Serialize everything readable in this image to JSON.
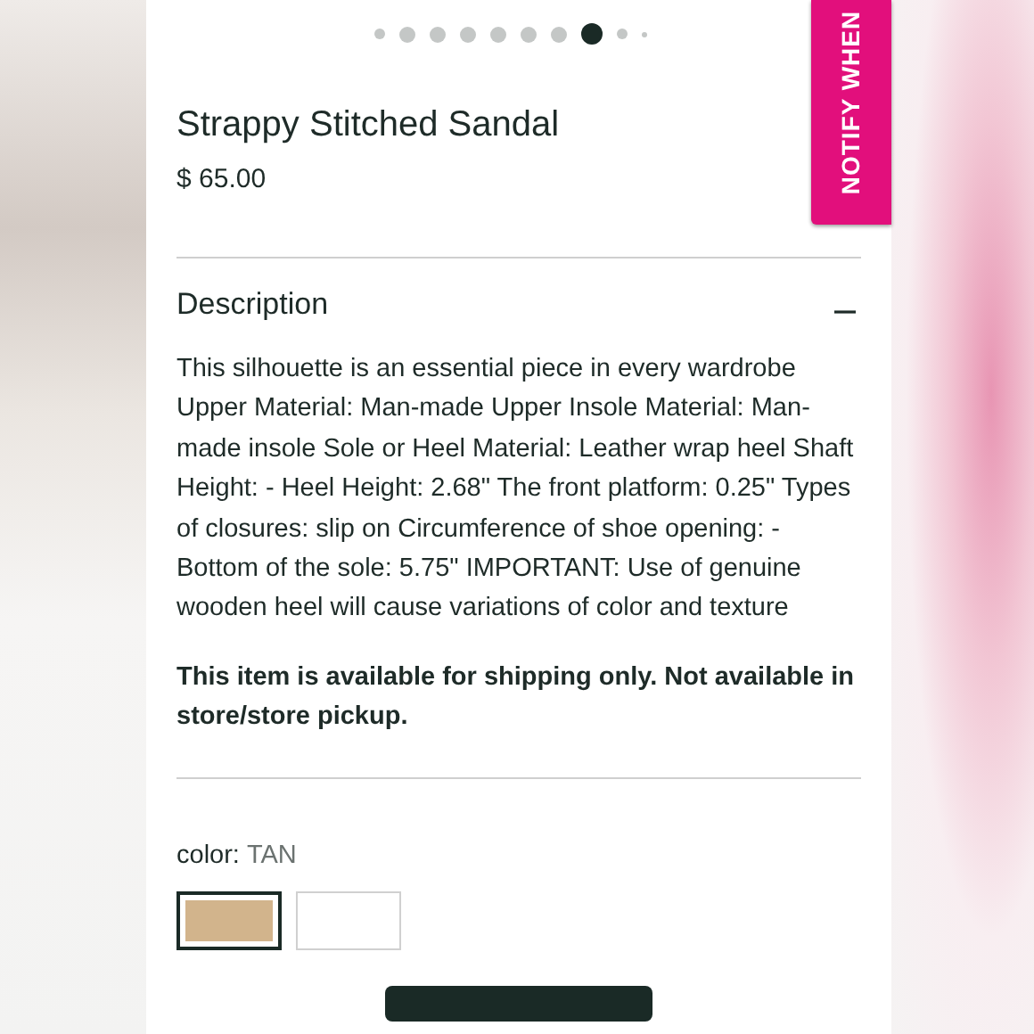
{
  "carousel_dots": [
    {
      "selected": false
    },
    {
      "selected": false
    },
    {
      "selected": false
    },
    {
      "selected": false
    },
    {
      "selected": false
    },
    {
      "selected": false
    },
    {
      "selected": false
    },
    {
      "selected": true
    },
    {
      "selected": false
    },
    {
      "selected": false
    }
  ],
  "notify_tab": {
    "label": "NOTIFY WHEN"
  },
  "product": {
    "title": "Strappy Stitched Sandal",
    "price": "$ 65.00"
  },
  "description": {
    "heading": "Description",
    "expanded": true,
    "body": "This silhouette is an essential piece in every wardrobe Upper Material: Man-made Upper Insole Material: Man-made insole Sole or Heel Material: Leather wrap heel Shaft Height: - Heel Height: 2.68\" The front platform: 0.25\" Types of closures: slip on Circumference of shoe opening: - Bottom of the sole: 5.75\" IMPORTANT: Use of genuine wooden heel will cause variations of color and texture",
    "notice": "This item is available for shipping only. Not available in store/store pickup."
  },
  "color_picker": {
    "label": "color:",
    "value": "TAN",
    "swatches": [
      {
        "color": "#d2b48c",
        "selected": true
      },
      {
        "color": "#ffffff",
        "selected": false
      }
    ]
  }
}
